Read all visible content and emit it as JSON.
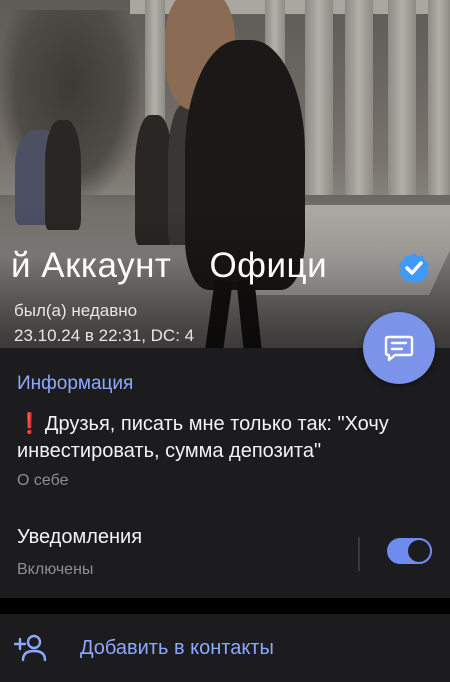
{
  "profile": {
    "name_part1": "й Аккаунт",
    "name_part2": "Офици",
    "status": "был(а) недавно",
    "last_seen": "23.10.24 в 22:31, DC: 4",
    "verified_icon": "verified-badge-icon"
  },
  "info": {
    "section_title": "Информация",
    "bio_mark": "❗",
    "bio_text": "Друзья, писать мне только так: \"Хочу инвестировать, сумма депозита\"",
    "bio_label": "О себе",
    "notifications_title": "Уведомления",
    "notifications_status": "Включены",
    "notifications_on": true
  },
  "actions": {
    "add_contact_label": "Добавить в контакты",
    "add_contact_icon": "add-user-icon",
    "message_icon": "message-icon"
  },
  "colors": {
    "accent": "#8ea8ff",
    "fab": "#7b93e8",
    "card_bg": "#1c1c1e",
    "secondary_text": "#8e8e93",
    "verified": "#3d9bf5"
  }
}
